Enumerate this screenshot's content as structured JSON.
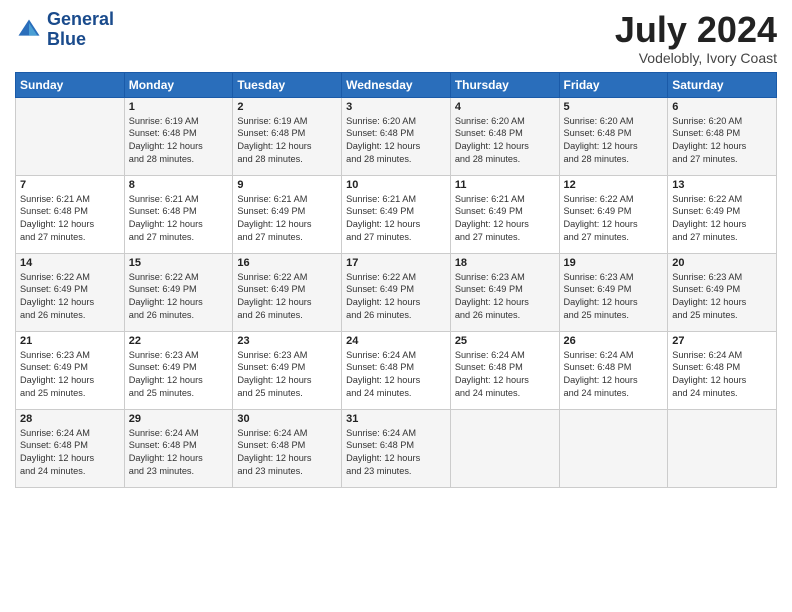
{
  "header": {
    "logo_line1": "General",
    "logo_line2": "Blue",
    "month_year": "July 2024",
    "location": "Vodelobly, Ivory Coast"
  },
  "days_of_week": [
    "Sunday",
    "Monday",
    "Tuesday",
    "Wednesday",
    "Thursday",
    "Friday",
    "Saturday"
  ],
  "weeks": [
    [
      {
        "day": "",
        "info": ""
      },
      {
        "day": "1",
        "info": "Sunrise: 6:19 AM\nSunset: 6:48 PM\nDaylight: 12 hours\nand 28 minutes."
      },
      {
        "day": "2",
        "info": "Sunrise: 6:19 AM\nSunset: 6:48 PM\nDaylight: 12 hours\nand 28 minutes."
      },
      {
        "day": "3",
        "info": "Sunrise: 6:20 AM\nSunset: 6:48 PM\nDaylight: 12 hours\nand 28 minutes."
      },
      {
        "day": "4",
        "info": "Sunrise: 6:20 AM\nSunset: 6:48 PM\nDaylight: 12 hours\nand 28 minutes."
      },
      {
        "day": "5",
        "info": "Sunrise: 6:20 AM\nSunset: 6:48 PM\nDaylight: 12 hours\nand 28 minutes."
      },
      {
        "day": "6",
        "info": "Sunrise: 6:20 AM\nSunset: 6:48 PM\nDaylight: 12 hours\nand 27 minutes."
      }
    ],
    [
      {
        "day": "7",
        "info": "Sunrise: 6:21 AM\nSunset: 6:48 PM\nDaylight: 12 hours\nand 27 minutes."
      },
      {
        "day": "8",
        "info": "Sunrise: 6:21 AM\nSunset: 6:48 PM\nDaylight: 12 hours\nand 27 minutes."
      },
      {
        "day": "9",
        "info": "Sunrise: 6:21 AM\nSunset: 6:49 PM\nDaylight: 12 hours\nand 27 minutes."
      },
      {
        "day": "10",
        "info": "Sunrise: 6:21 AM\nSunset: 6:49 PM\nDaylight: 12 hours\nand 27 minutes."
      },
      {
        "day": "11",
        "info": "Sunrise: 6:21 AM\nSunset: 6:49 PM\nDaylight: 12 hours\nand 27 minutes."
      },
      {
        "day": "12",
        "info": "Sunrise: 6:22 AM\nSunset: 6:49 PM\nDaylight: 12 hours\nand 27 minutes."
      },
      {
        "day": "13",
        "info": "Sunrise: 6:22 AM\nSunset: 6:49 PM\nDaylight: 12 hours\nand 27 minutes."
      }
    ],
    [
      {
        "day": "14",
        "info": "Sunrise: 6:22 AM\nSunset: 6:49 PM\nDaylight: 12 hours\nand 26 minutes."
      },
      {
        "day": "15",
        "info": "Sunrise: 6:22 AM\nSunset: 6:49 PM\nDaylight: 12 hours\nand 26 minutes."
      },
      {
        "day": "16",
        "info": "Sunrise: 6:22 AM\nSunset: 6:49 PM\nDaylight: 12 hours\nand 26 minutes."
      },
      {
        "day": "17",
        "info": "Sunrise: 6:22 AM\nSunset: 6:49 PM\nDaylight: 12 hours\nand 26 minutes."
      },
      {
        "day": "18",
        "info": "Sunrise: 6:23 AM\nSunset: 6:49 PM\nDaylight: 12 hours\nand 26 minutes."
      },
      {
        "day": "19",
        "info": "Sunrise: 6:23 AM\nSunset: 6:49 PM\nDaylight: 12 hours\nand 25 minutes."
      },
      {
        "day": "20",
        "info": "Sunrise: 6:23 AM\nSunset: 6:49 PM\nDaylight: 12 hours\nand 25 minutes."
      }
    ],
    [
      {
        "day": "21",
        "info": "Sunrise: 6:23 AM\nSunset: 6:49 PM\nDaylight: 12 hours\nand 25 minutes."
      },
      {
        "day": "22",
        "info": "Sunrise: 6:23 AM\nSunset: 6:49 PM\nDaylight: 12 hours\nand 25 minutes."
      },
      {
        "day": "23",
        "info": "Sunrise: 6:23 AM\nSunset: 6:49 PM\nDaylight: 12 hours\nand 25 minutes."
      },
      {
        "day": "24",
        "info": "Sunrise: 6:24 AM\nSunset: 6:48 PM\nDaylight: 12 hours\nand 24 minutes."
      },
      {
        "day": "25",
        "info": "Sunrise: 6:24 AM\nSunset: 6:48 PM\nDaylight: 12 hours\nand 24 minutes."
      },
      {
        "day": "26",
        "info": "Sunrise: 6:24 AM\nSunset: 6:48 PM\nDaylight: 12 hours\nand 24 minutes."
      },
      {
        "day": "27",
        "info": "Sunrise: 6:24 AM\nSunset: 6:48 PM\nDaylight: 12 hours\nand 24 minutes."
      }
    ],
    [
      {
        "day": "28",
        "info": "Sunrise: 6:24 AM\nSunset: 6:48 PM\nDaylight: 12 hours\nand 24 minutes."
      },
      {
        "day": "29",
        "info": "Sunrise: 6:24 AM\nSunset: 6:48 PM\nDaylight: 12 hours\nand 23 minutes."
      },
      {
        "day": "30",
        "info": "Sunrise: 6:24 AM\nSunset: 6:48 PM\nDaylight: 12 hours\nand 23 minutes."
      },
      {
        "day": "31",
        "info": "Sunrise: 6:24 AM\nSunset: 6:48 PM\nDaylight: 12 hours\nand 23 minutes."
      },
      {
        "day": "",
        "info": ""
      },
      {
        "day": "",
        "info": ""
      },
      {
        "day": "",
        "info": ""
      }
    ]
  ]
}
